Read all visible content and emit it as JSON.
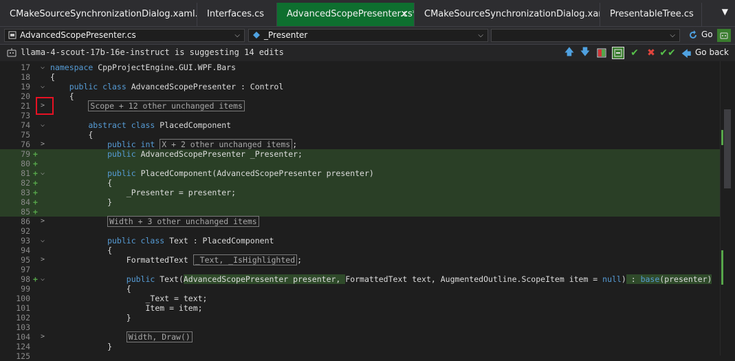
{
  "tabs": [
    {
      "label": "CMakeSourceSynchronizationDialog.xaml.cs",
      "active": false
    },
    {
      "label": "Interfaces.cs",
      "active": false
    },
    {
      "label": "AdvancedScopePresenter.cs*",
      "active": true
    },
    {
      "label": "CMakeSourceSynchronizationDialog.xaml",
      "active": false
    },
    {
      "label": "PresentableTree.cs",
      "active": false
    }
  ],
  "tab_close_glyph": "✕",
  "tab_dropdown_glyph": "▼",
  "navbar": {
    "file_combo": "AdvancedScopePresenter.cs",
    "member_combo": "_Presenter",
    "third_combo": "",
    "go_label": "Go"
  },
  "infobar": {
    "message": "llama-4-scout-17b-16e-instruct is suggesting 14 edits",
    "go_back_label": "Go back"
  },
  "icons": {
    "up": "up-arrow-icon",
    "down": "down-arrow-icon",
    "diff": "diff-view-icon",
    "inline": "inline-view-icon",
    "accept": "accept-icon",
    "reject": "reject-icon",
    "accept_all": "accept-all-icon",
    "go_back": "go-back-icon"
  },
  "colors": {
    "active_tab": "#0e6f2f",
    "added_line": "#2a3f26",
    "keyword": "#569cd6",
    "highlight_box": "#e81123"
  },
  "lines": [
    {
      "num": "17",
      "fold": "⌵",
      "plus": "",
      "added": false,
      "segs": [
        {
          "t": "namespace ",
          "c": "kw"
        },
        {
          "t": "CppProjectEngine.GUI.WPF.Bars",
          "c": ""
        }
      ]
    },
    {
      "num": "18",
      "fold": "",
      "plus": "",
      "added": false,
      "segs": [
        {
          "t": "{",
          "c": ""
        }
      ]
    },
    {
      "num": "19",
      "fold": "⌵",
      "plus": "",
      "added": false,
      "segs": [
        {
          "t": "    public class ",
          "c": "kw"
        },
        {
          "t": "AdvancedScopePresenter : Control",
          "c": ""
        }
      ]
    },
    {
      "num": "20",
      "fold": "",
      "plus": "",
      "added": false,
      "segs": [
        {
          "t": "    {",
          "c": ""
        }
      ]
    },
    {
      "num": "21",
      "fold": ">",
      "plus": "",
      "added": false,
      "segs": [
        {
          "t": "        ",
          "c": ""
        },
        {
          "t": "Scope + 12 other unchanged items",
          "c": "box"
        }
      ]
    },
    {
      "num": "73",
      "fold": "",
      "plus": "",
      "added": false,
      "segs": [
        {
          "t": "",
          "c": ""
        }
      ]
    },
    {
      "num": "74",
      "fold": "⌵",
      "plus": "",
      "added": false,
      "segs": [
        {
          "t": "        abstract class ",
          "c": "kw"
        },
        {
          "t": "PlacedComponent",
          "c": ""
        }
      ]
    },
    {
      "num": "75",
      "fold": "",
      "plus": "",
      "added": false,
      "segs": [
        {
          "t": "        {",
          "c": ""
        }
      ]
    },
    {
      "num": "76",
      "fold": ">",
      "plus": "",
      "added": false,
      "segs": [
        {
          "t": "            public int ",
          "c": "kw"
        },
        {
          "t": "X + 2 other unchanged items",
          "c": "box"
        },
        {
          "t": ";",
          "c": ""
        }
      ]
    },
    {
      "num": "79",
      "fold": "",
      "plus": "+",
      "added": true,
      "segs": [
        {
          "t": "            public ",
          "c": "kw"
        },
        {
          "t": "AdvancedScopePresenter _Presenter;",
          "c": ""
        }
      ]
    },
    {
      "num": "80",
      "fold": "",
      "plus": "+",
      "added": true,
      "segs": [
        {
          "t": "",
          "c": ""
        }
      ]
    },
    {
      "num": "81",
      "fold": "⌵",
      "plus": "+",
      "added": true,
      "segs": [
        {
          "t": "            public ",
          "c": "kw"
        },
        {
          "t": "PlacedComponent(AdvancedScopePresenter presenter)",
          "c": ""
        }
      ]
    },
    {
      "num": "82",
      "fold": "",
      "plus": "+",
      "added": true,
      "segs": [
        {
          "t": "            {",
          "c": ""
        }
      ]
    },
    {
      "num": "83",
      "fold": "",
      "plus": "+",
      "added": true,
      "segs": [
        {
          "t": "                _Presenter = presenter;",
          "c": ""
        }
      ]
    },
    {
      "num": "84",
      "fold": "",
      "plus": "+",
      "added": true,
      "segs": [
        {
          "t": "            }",
          "c": ""
        }
      ]
    },
    {
      "num": "85",
      "fold": "",
      "plus": "+",
      "added": true,
      "segs": [
        {
          "t": "",
          "c": ""
        }
      ]
    },
    {
      "num": "86",
      "fold": ">",
      "plus": "",
      "added": false,
      "segs": [
        {
          "t": "            ",
          "c": ""
        },
        {
          "t": "Width + 3 other unchanged items",
          "c": "box"
        }
      ]
    },
    {
      "num": "92",
      "fold": "",
      "plus": "",
      "added": false,
      "segs": [
        {
          "t": "",
          "c": ""
        }
      ]
    },
    {
      "num": "93",
      "fold": "⌵",
      "plus": "",
      "added": false,
      "segs": [
        {
          "t": "            public class ",
          "c": "kw"
        },
        {
          "t": "Text : PlacedComponent",
          "c": ""
        }
      ]
    },
    {
      "num": "94",
      "fold": "",
      "plus": "",
      "added": false,
      "segs": [
        {
          "t": "            {",
          "c": ""
        }
      ]
    },
    {
      "num": "95",
      "fold": ">",
      "plus": "",
      "added": false,
      "segs": [
        {
          "t": "                FormattedText ",
          "c": ""
        },
        {
          "t": "_Text, _IsHighlighted",
          "c": "box"
        },
        {
          "t": ";",
          "c": ""
        }
      ]
    },
    {
      "num": "97",
      "fold": "",
      "plus": "",
      "added": false,
      "segs": [
        {
          "t": "",
          "c": ""
        }
      ]
    },
    {
      "num": "98",
      "fold": "⌵",
      "plus": "+",
      "added": false,
      "segs": [
        {
          "t": "                public ",
          "c": "kw"
        },
        {
          "t": "Text(",
          "c": ""
        },
        {
          "t": "AdvancedScopePresenter presenter, ",
          "c": "hl"
        },
        {
          "t": "FormattedText text, AugmentedOutline.ScopeItem item = ",
          "c": ""
        },
        {
          "t": "null",
          "c": "kw"
        },
        {
          "t": ")",
          "c": ""
        },
        {
          "t": " : ",
          "c": "hl"
        },
        {
          "t": "base",
          "c": "kw hl"
        },
        {
          "t": "(presenter)",
          "c": "hl"
        }
      ]
    },
    {
      "num": "99",
      "fold": "",
      "plus": "",
      "added": false,
      "segs": [
        {
          "t": "                {",
          "c": ""
        }
      ]
    },
    {
      "num": "100",
      "fold": "",
      "plus": "",
      "added": false,
      "segs": [
        {
          "t": "                    _Text = text;",
          "c": ""
        }
      ]
    },
    {
      "num": "101",
      "fold": "",
      "plus": "",
      "added": false,
      "segs": [
        {
          "t": "                    Item = item;",
          "c": ""
        }
      ]
    },
    {
      "num": "102",
      "fold": "",
      "plus": "",
      "added": false,
      "segs": [
        {
          "t": "                }",
          "c": ""
        }
      ]
    },
    {
      "num": "103",
      "fold": "",
      "plus": "",
      "added": false,
      "segs": [
        {
          "t": "",
          "c": ""
        }
      ]
    },
    {
      "num": "104",
      "fold": ">",
      "plus": "",
      "added": false,
      "segs": [
        {
          "t": "                ",
          "c": ""
        },
        {
          "t": "Width, Draw()",
          "c": "box"
        }
      ]
    },
    {
      "num": "124",
      "fold": "",
      "plus": "",
      "added": false,
      "segs": [
        {
          "t": "            }",
          "c": ""
        }
      ]
    },
    {
      "num": "125",
      "fold": "",
      "plus": "",
      "added": false,
      "segs": [
        {
          "t": "",
          "c": ""
        }
      ]
    }
  ]
}
